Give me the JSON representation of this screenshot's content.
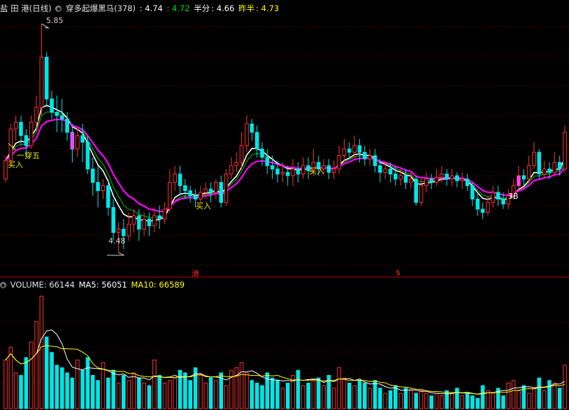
{
  "main_panel": {
    "name": "盐 田 港(日线)",
    "indicator": "穿多起爆黑马(378)",
    "v1": ": 4.74",
    "v2": ": 4.72",
    "half_label": "半分",
    "half_value": ": 4.66",
    "prev_label": "昨半",
    "prev_value": ": 4.73",
    "high_label": "5.85",
    "low_label": "4.48",
    "signals": [
      "一穿五",
      "买入",
      "买入",
      "买入",
      "3B"
    ],
    "marker_gang": "港",
    "marker_s": "$"
  },
  "volume_panel": {
    "volume_label": "VOLUME: 66144",
    "ma5_label": "MA5: 56051",
    "ma10_label": "MA10: 66589"
  },
  "colors": {
    "up": "#ff3232",
    "down": "#00e6e6",
    "ma_white": "#ffffff",
    "ma_magenta": "#ff00ff",
    "ma_green": "#00c000",
    "ma_yellow": "#ffff00",
    "grid": "#7a0000",
    "text": "#c8c8c8"
  },
  "chart_data": {
    "type": "candlestick",
    "ylim": [
      4.4,
      5.9
    ],
    "high": 5.85,
    "low": 4.48,
    "candles": [
      [
        4.92,
        5.03,
        4.9,
        5.06
      ],
      [
        5.03,
        5.22,
        5.0,
        5.25
      ],
      [
        5.22,
        5.26,
        5.15,
        5.3
      ],
      [
        5.26,
        5.18,
        5.12,
        5.3
      ],
      [
        5.18,
        5.12,
        5.05,
        5.22
      ],
      [
        5.12,
        5.26,
        5.1,
        5.3
      ],
      [
        5.26,
        5.35,
        5.2,
        5.42
      ],
      [
        5.35,
        5.65,
        5.3,
        5.85
      ],
      [
        5.65,
        5.4,
        5.35,
        5.68
      ],
      [
        5.4,
        5.32,
        5.28,
        5.45
      ],
      [
        5.32,
        5.3,
        5.2,
        5.42
      ],
      [
        5.3,
        5.28,
        5.2,
        5.4
      ],
      [
        5.28,
        5.2,
        5.15,
        5.32
      ],
      [
        5.2,
        5.1,
        5.02,
        5.25
      ],
      [
        5.1,
        5.18,
        5.05,
        5.22
      ],
      [
        5.18,
        5.14,
        5.02,
        5.25
      ],
      [
        5.14,
        4.98,
        4.95,
        5.18
      ],
      [
        4.98,
        4.9,
        4.82,
        5.05
      ],
      [
        4.9,
        4.85,
        4.75,
        5.0
      ],
      [
        4.85,
        4.88,
        4.8,
        4.92
      ],
      [
        4.88,
        4.75,
        4.7,
        4.92
      ],
      [
        4.75,
        4.6,
        4.55,
        4.8
      ],
      [
        4.6,
        4.62,
        4.48,
        4.66
      ],
      [
        4.62,
        4.58,
        4.5,
        4.68
      ],
      [
        4.58,
        4.65,
        4.55,
        4.72
      ],
      [
        4.65,
        4.7,
        4.6,
        4.74
      ],
      [
        4.7,
        4.62,
        4.55,
        4.74
      ],
      [
        4.62,
        4.68,
        4.58,
        4.72
      ],
      [
        4.68,
        4.64,
        4.58,
        4.72
      ],
      [
        4.64,
        4.7,
        4.6,
        4.75
      ],
      [
        4.7,
        4.68,
        4.62,
        4.76
      ],
      [
        4.68,
        4.74,
        4.65,
        4.78
      ],
      [
        4.74,
        4.9,
        4.72,
        4.98
      ],
      [
        4.9,
        4.95,
        4.85,
        5.0
      ],
      [
        4.95,
        4.88,
        4.82,
        5.0
      ],
      [
        4.88,
        4.85,
        4.8,
        4.92
      ],
      [
        4.85,
        4.82,
        4.78,
        4.88
      ],
      [
        4.82,
        4.8,
        4.75,
        4.86
      ],
      [
        4.8,
        4.84,
        4.78,
        4.88
      ],
      [
        4.84,
        4.86,
        4.8,
        4.9
      ],
      [
        4.86,
        4.84,
        4.78,
        4.9
      ],
      [
        4.84,
        4.9,
        4.8,
        4.92
      ],
      [
        4.9,
        4.78,
        4.75,
        4.94
      ],
      [
        4.78,
        4.95,
        4.76,
        4.98
      ],
      [
        4.95,
        5.0,
        4.92,
        5.05
      ],
      [
        5.0,
        5.02,
        4.96,
        5.08
      ],
      [
        5.02,
        5.12,
        4.98,
        5.2
      ],
      [
        5.12,
        5.25,
        5.08,
        5.3
      ],
      [
        5.25,
        5.2,
        5.15,
        5.28
      ],
      [
        5.2,
        5.1,
        5.05,
        5.24
      ],
      [
        5.1,
        5.05,
        5.0,
        5.14
      ],
      [
        5.05,
        5.0,
        4.95,
        5.1
      ],
      [
        5.0,
        4.98,
        4.92,
        5.06
      ],
      [
        4.98,
        4.95,
        4.9,
        5.03
      ],
      [
        4.95,
        4.96,
        4.9,
        5.02
      ],
      [
        4.96,
        4.94,
        4.88,
        5.0
      ],
      [
        4.94,
        4.98,
        4.88,
        5.04
      ],
      [
        4.98,
        4.95,
        4.9,
        5.02
      ],
      [
        4.95,
        5.0,
        4.92,
        5.05
      ],
      [
        5.0,
        4.97,
        4.92,
        5.05
      ],
      [
        4.97,
        5.02,
        4.94,
        5.1
      ],
      [
        5.02,
        4.98,
        4.94,
        5.06
      ],
      [
        4.98,
        5.0,
        4.95,
        5.04
      ],
      [
        5.0,
        4.96,
        4.92,
        5.04
      ],
      [
        4.96,
        4.98,
        4.92,
        5.03
      ],
      [
        4.98,
        5.06,
        4.95,
        5.12
      ],
      [
        5.06,
        5.1,
        5.02,
        5.16
      ],
      [
        5.1,
        5.08,
        5.04,
        5.14
      ],
      [
        5.08,
        5.12,
        5.04,
        5.18
      ],
      [
        5.12,
        5.08,
        5.02,
        5.16
      ],
      [
        5.08,
        5.04,
        5.0,
        5.12
      ],
      [
        5.04,
        5.06,
        5.0,
        5.1
      ],
      [
        5.06,
        5.0,
        4.96,
        5.1
      ],
      [
        5.0,
        4.96,
        4.9,
        5.04
      ],
      [
        4.96,
        4.98,
        4.92,
        5.02
      ],
      [
        4.98,
        4.95,
        4.9,
        5.02
      ],
      [
        4.95,
        4.92,
        4.88,
        5.0
      ],
      [
        4.92,
        4.94,
        4.88,
        4.98
      ],
      [
        4.94,
        4.9,
        4.86,
        4.98
      ],
      [
        4.9,
        4.92,
        4.86,
        4.96
      ],
      [
        4.92,
        4.78,
        4.76,
        4.94
      ],
      [
        4.78,
        4.88,
        4.76,
        4.92
      ],
      [
        4.88,
        4.92,
        4.84,
        4.96
      ],
      [
        4.92,
        4.9,
        4.86,
        4.95
      ],
      [
        4.9,
        4.93,
        4.88,
        4.98
      ],
      [
        4.93,
        4.95,
        4.9,
        5.0
      ],
      [
        4.95,
        4.92,
        4.88,
        4.98
      ],
      [
        4.92,
        4.94,
        4.88,
        4.98
      ],
      [
        4.94,
        4.91,
        4.87,
        4.96
      ],
      [
        4.91,
        4.92,
        4.86,
        4.96
      ],
      [
        4.92,
        4.88,
        4.85,
        4.95
      ],
      [
        4.88,
        4.8,
        4.76,
        4.9
      ],
      [
        4.8,
        4.74,
        4.7,
        4.84
      ],
      [
        4.74,
        4.72,
        4.68,
        4.78
      ],
      [
        4.72,
        4.78,
        4.7,
        4.82
      ],
      [
        4.78,
        4.84,
        4.75,
        4.88
      ],
      [
        4.84,
        4.8,
        4.76,
        4.88
      ],
      [
        4.8,
        4.77,
        4.74,
        4.84
      ],
      [
        4.77,
        4.82,
        4.74,
        4.86
      ],
      [
        4.82,
        4.88,
        4.8,
        4.92
      ],
      [
        4.88,
        4.94,
        4.85,
        5.0
      ],
      [
        4.94,
        4.92,
        4.88,
        4.98
      ],
      [
        4.92,
        5.0,
        4.9,
        5.06
      ],
      [
        5.0,
        5.08,
        4.98,
        5.14
      ],
      [
        5.08,
        4.95,
        4.92,
        5.1
      ],
      [
        4.95,
        4.98,
        4.92,
        5.03
      ],
      [
        4.98,
        4.96,
        4.92,
        5.02
      ],
      [
        4.96,
        5.02,
        4.94,
        5.08
      ],
      [
        5.02,
        4.98,
        4.94,
        5.06
      ],
      [
        4.98,
        5.2,
        4.96,
        5.24
      ]
    ],
    "volume": [
      95,
      120,
      70,
      65,
      100,
      130,
      170,
      220,
      140,
      110,
      85,
      80,
      70,
      60,
      95,
      75,
      100,
      65,
      55,
      90,
      60,
      75,
      50,
      65,
      55,
      70,
      60,
      50,
      45,
      95,
      65,
      50,
      55,
      60,
      75,
      70,
      55,
      80,
      65,
      50,
      60,
      55,
      70,
      45,
      75,
      80,
      90,
      70,
      55,
      50,
      45,
      70,
      60,
      55,
      40,
      50,
      65,
      75,
      45,
      50,
      55,
      60,
      45,
      65,
      40,
      80,
      60,
      50,
      45,
      55,
      50,
      40,
      55,
      40,
      30,
      35,
      45,
      30,
      40,
      35,
      30,
      35,
      30,
      25,
      30,
      25,
      35,
      30,
      40,
      25,
      30,
      25,
      20,
      45,
      35,
      30,
      40,
      25,
      50,
      55,
      35,
      45,
      30,
      40,
      60,
      35,
      55,
      50,
      40,
      85
    ],
    "vol_ylim": [
      0,
      230
    ]
  }
}
